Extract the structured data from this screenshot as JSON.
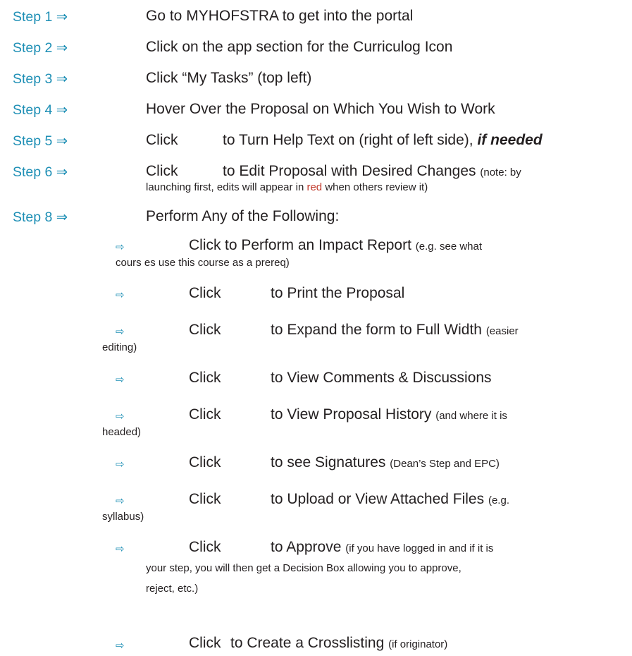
{
  "steps": [
    {
      "label": "Step 1 ⇒",
      "text": "Go to MYHOFSTRA to get into the portal"
    },
    {
      "label": "Step 2 ⇒",
      "text": "Click on the app section for the Curriculog Icon"
    },
    {
      "label": "Step 3 ⇒",
      "text": "Click “My Tasks” (top left)"
    },
    {
      "label": "Step 4 ⇒",
      "text": "Hover Over the Proposal on Which You Wish to Work"
    },
    {
      "label": "Step 5 ⇒",
      "click": "Click",
      "text": "to Turn Help Text on (right of left side),",
      "emph": "if needed"
    },
    {
      "label": "Step 6 ⇒",
      "click": "Click",
      "text": "to Edit Proposal with Desired Changes",
      "note_a": "(note: by",
      "note_b": "launching first, edits will appear in",
      "note_red": "red",
      "note_c": "when others review it)"
    },
    {
      "label": "Step 8 ⇒",
      "text": "Perform Any of the Following:"
    }
  ],
  "arrow_glyph": "⇨",
  "subitems": [
    {
      "click": "Click",
      "text": "to Perform an Impact Report",
      "note": "(e.g. see what",
      "note2": "cours es use this course as a prereq)"
    },
    {
      "click": "Click",
      "text": "to Print the Proposal"
    },
    {
      "click": "Click",
      "text": "to Expand the form to Full Width",
      "note": "(easier",
      "note2": "editing)"
    },
    {
      "click": "Click",
      "text": "to View Comments & Discussions"
    },
    {
      "click": "Click",
      "text": "to View Proposal History",
      "note": "(and where it is",
      "note2": "headed)"
    },
    {
      "click": "Click",
      "text": "to see Signatures",
      "note": "(Dean’s Step and EPC)"
    },
    {
      "click": "Click",
      "text": "to Upload or View Attached Files",
      "note": "(e.g.",
      "note2": "syllabus)"
    },
    {
      "click": "Click",
      "text": "to Approve",
      "note": "(if you have logged in and if it is",
      "note2": "your step, you will then get a Decision Box allowing you to approve,",
      "note3": "reject, etc.)"
    },
    {
      "click": "Click",
      "text": "to Create a Crosslisting",
      "note": "(if originator)"
    }
  ]
}
